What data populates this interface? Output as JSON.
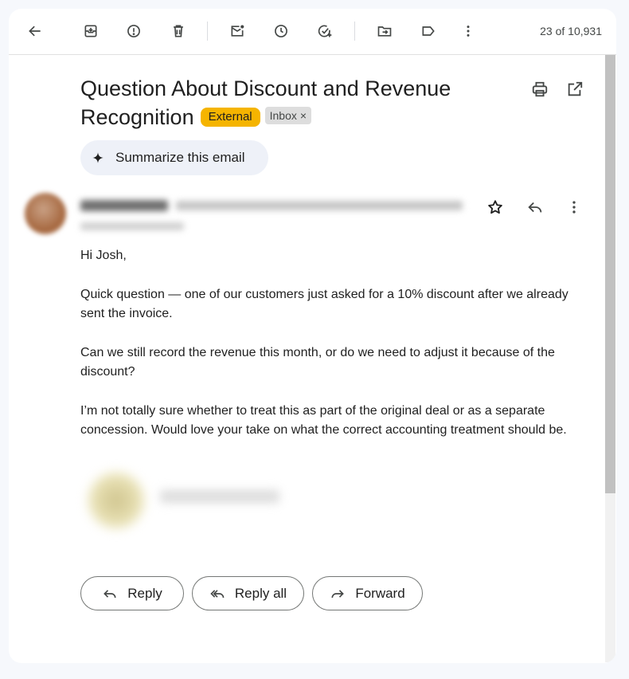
{
  "toolbar": {
    "back_icon": "arrow-left-icon",
    "archive_icon": "archive-icon",
    "spam_icon": "report-spam-icon",
    "delete_icon": "trash-icon",
    "unread_icon": "mark-unread-icon",
    "snooze_icon": "snooze-clock-icon",
    "task_icon": "add-task-icon",
    "move_icon": "move-to-folder-icon",
    "label_icon": "label-icon",
    "more_icon": "more-vertical-icon",
    "pager": "23 of 10,931"
  },
  "email": {
    "subject": "Question About Discount and Revenue Recognition",
    "chip_external": "External",
    "chip_inbox": "Inbox",
    "chip_inbox_close": "×",
    "print_icon": "print-icon",
    "new_window_icon": "open-in-new-window-icon",
    "summarize_label": "Summarize this email",
    "summarize_icon": "sparkle-icon",
    "star_icon": "star-icon",
    "reply_icon": "reply-icon",
    "more_icon": "more-vertical-icon",
    "greeting": "Hi Josh,",
    "paragraphs": [
      "Quick question — one of our customers just asked for a 10% discount after we already sent the invoice.",
      "Can we still record the revenue this month, or do we need to adjust it because of the discount?",
      "I’m not totally sure whether to treat this as part of the original deal or as a separate concession. Would love your take on what the correct accounting treatment should be."
    ]
  },
  "actions": {
    "reply": "Reply",
    "reply_all": "Reply all",
    "forward": "Forward"
  },
  "colors": {
    "external_chip": "#f5b400",
    "inbox_chip": "#dddddd",
    "summarize_bg": "#eef1f8",
    "page_bg": "#f6f8fc"
  }
}
